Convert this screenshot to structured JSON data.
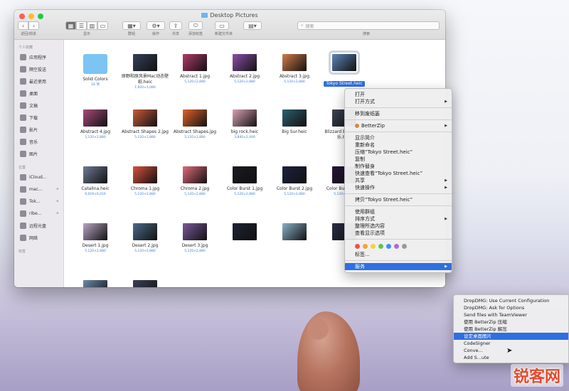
{
  "window": {
    "title": "Desktop Pictures",
    "toolbar": {
      "back_forward_label": "返回/前进",
      "view_label": "显示",
      "group_label": "群组",
      "action_label": "操作",
      "share_label": "共享",
      "tags_label": "添加标签",
      "new_folder_label": "新建文件夹",
      "search_label": "搜索",
      "search_placeholder": "搜索"
    }
  },
  "sidebar": {
    "favorites_head": "个人收藏",
    "favorites": [
      {
        "label": "应用程序",
        "icon": "applications-icon"
      },
      {
        "label": "隔空投送",
        "icon": "airdrop-icon"
      },
      {
        "label": "最近使用",
        "icon": "recents-icon"
      },
      {
        "label": "桌面",
        "icon": "desktop-icon"
      },
      {
        "label": "文稿",
        "icon": "documents-icon"
      },
      {
        "label": "下载",
        "icon": "downloads-icon"
      },
      {
        "label": "影片",
        "icon": "movies-icon"
      },
      {
        "label": "音乐",
        "icon": "music-icon"
      },
      {
        "label": "图片",
        "icon": "pictures-icon"
      }
    ],
    "locations_head": "位置",
    "locations": [
      {
        "label": "iCloud...",
        "icon": "icloud-icon",
        "eject": ""
      },
      {
        "label": "mac...",
        "icon": "disk-icon",
        "eject": "≙"
      },
      {
        "label": "Tok...",
        "icon": "disk-icon",
        "eject": "≙"
      },
      {
        "label": "ribe...",
        "icon": "disk-icon",
        "eject": "≙"
      },
      {
        "label": "远程光盘",
        "icon": "disc-icon",
        "eject": ""
      },
      {
        "label": "网络",
        "icon": "network-icon",
        "eject": ""
      }
    ],
    "tags_head": "标签"
  },
  "files": [
    {
      "name": "Solid Colors",
      "meta": "16 项",
      "color": "#7cc4f4"
    },
    {
      "name": "原野和原风景Mac动态壁纸.heic",
      "meta": "1,920×1,080",
      "color": "#35405a"
    },
    {
      "name": "Abstract 1.jpg",
      "meta": "5,120×2,880",
      "color": "#b23a6a"
    },
    {
      "name": "Abstract 2.jpg",
      "meta": "5,120×2,880",
      "color": "#8e4fa8"
    },
    {
      "name": "Abstract 3.jpg",
      "meta": "5,120×2,880",
      "color": "#d27c4a"
    },
    {
      "name": "Tokyo Street.heic",
      "meta": "",
      "color": "#5c86b7"
    },
    {
      "name": "Abstract 4.jpg",
      "meta": "5,120×2,880",
      "color": "#a74a7c"
    },
    {
      "name": "Abstract Shapes 2.jpg",
      "meta": "5,120×2,880",
      "color": "#c85a3a"
    },
    {
      "name": "Abstract Shapes.jpg",
      "meta": "5,120×2,880",
      "color": "#e0622a"
    },
    {
      "name": "big rock.heic",
      "meta": "3,840×2,400",
      "color": "#d9a0b4"
    },
    {
      "name": "Big Sur.heic",
      "meta": "",
      "color": "#2c5f6e"
    },
    {
      "name": "Blizzard Entertai...乐.heic",
      "meta": "",
      "color": "#3d4656"
    },
    {
      "name": "Catalina.heic",
      "meta": "6,016×6,016",
      "color": "#6f7a95"
    },
    {
      "name": "Chroma 1.jpg",
      "meta": "5,120×2,880",
      "color": "#d8503e"
    },
    {
      "name": "Chroma 2.jpg",
      "meta": "5,120×2,880",
      "color": "#e06a7a"
    },
    {
      "name": "Color Burst 1.jpg",
      "meta": "5,120×2,880",
      "color": "#1a1a22"
    },
    {
      "name": "Color Burst 2.jpg",
      "meta": "5,120×2,880",
      "color": "#1c2240"
    },
    {
      "name": "Color Burst 3.jpg",
      "meta": "5,120×2,880",
      "color": "#27143a"
    },
    {
      "name": "Desert 1.jpg",
      "meta": "5,120×2,880",
      "color": "#b9a6c4"
    },
    {
      "name": "Desert 2.jpg",
      "meta": "5,120×2,880",
      "color": "#4d6a8a"
    },
    {
      "name": "Desert 3.jpg",
      "meta": "5,120×2,880",
      "color": "#7a5a9a"
    },
    {
      "name": "",
      "meta": "",
      "color": "#1e2233"
    },
    {
      "name": "",
      "meta": "",
      "color": "#8ab0c8"
    },
    {
      "name": "",
      "meta": "",
      "color": "#2a3048"
    },
    {
      "name": "",
      "meta": "",
      "color": "#6a8aa8"
    },
    {
      "name": "",
      "meta": "",
      "color": "#3a3f55"
    }
  ],
  "context_menu": {
    "open": "打开",
    "open_with": "打开方式",
    "move_to_trash": "移到废纸篓",
    "betterzip": "BetterZip",
    "get_info": "显示简介",
    "rename": "重新命名",
    "compress": "压缩“Tokyo Street.heic”",
    "duplicate": "复制",
    "make_alias": "制作替身",
    "quick_look": "快速查看“Tokyo Street.heic”",
    "share": "共享",
    "quick_actions": "快速操作",
    "copy": "拷贝“Tokyo Street.heic”",
    "use_groups": "使用群组",
    "sort_by": "排序方式",
    "clean_up": "整理所选内容",
    "show_view_options": "查看显示选项",
    "tag_colors": [
      "#f0524d",
      "#f4a431",
      "#f6d33c",
      "#5fc254",
      "#3f8ef5",
      "#b06bd6",
      "#9a9a9a"
    ],
    "tags": "标签...",
    "services": "服务"
  },
  "services_menu": {
    "items": [
      "DropDMG: Use Current Configuration",
      "DropDMG: Ask for Options",
      "Send files with TeamViewer",
      "使用 BetterZip 压缩",
      "使用 BetterZip 解压",
      "设定桌面图片",
      "CodeSigner",
      "Conve...",
      "Add S...ute"
    ],
    "highlighted_index": 5
  },
  "watermark": "锐客网"
}
